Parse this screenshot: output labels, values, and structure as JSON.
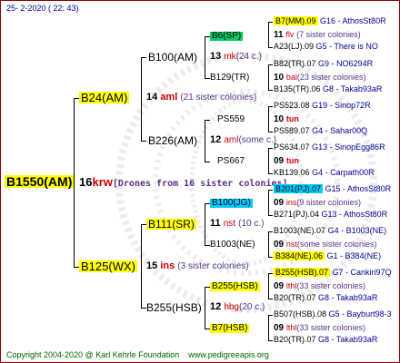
{
  "header": {
    "timestamp": "25-  2-2020 ( 22: 43)"
  },
  "root": {
    "name": "B1550(AM)",
    "num": "16",
    "code": "krw",
    "note": "[Drones from 16 sister colonies]"
  },
  "l1": [
    {
      "name": "B24(AM)",
      "num": "14",
      "code": "aml",
      "note": "(21 sister colonies)"
    },
    {
      "name": "B125(WX)",
      "num": "15",
      "code": "ins",
      "note": "(3 sister colonies)"
    }
  ],
  "l2": [
    {
      "name": "B100(AM)",
      "num": "13",
      "code": "mk",
      "note": "(24 c.)"
    },
    {
      "name": "B226(AM)",
      "num": "12",
      "code": "aml",
      "note": "(some c.)"
    },
    {
      "name": "B111(SR)",
      "num": "11",
      "code": "nst",
      "note": "(10 c.)"
    },
    {
      "name": "B255(HSB)",
      "num": "12",
      "code": "hbg",
      "note": "(20 c.)"
    }
  ],
  "l3": [
    {
      "name": "B6(SP)"
    },
    {
      "name": "B129(TR)"
    },
    {
      "name": "PS559"
    },
    {
      "name": "PS667"
    },
    {
      "name": "B100(JG)"
    },
    {
      "name": "B1003(NE)"
    },
    {
      "name": "B255(HSB)"
    },
    {
      "name": "B7(HSB)"
    }
  ],
  "l3info": [
    {
      "num": "11",
      "code": "flv",
      "note": "(7 sister colonies)"
    },
    {
      "num": "10",
      "code": "bal",
      "note": "(23 sister colonies)"
    },
    {
      "num": "10",
      "code": "tun",
      "note": ""
    },
    {
      "num": "09",
      "code": "tun",
      "note": ""
    },
    {
      "num": "09",
      "code": "ins",
      "note": "(9 sister colonies)"
    },
    {
      "num": "09",
      "code": "nst",
      "note": "(some sister colonies)"
    },
    {
      "num": "09",
      "code": "lthl",
      "note": "(33 sister colonies)"
    },
    {
      "num": "09",
      "code": "lthl",
      "note": "(33 sister colonies)"
    }
  ],
  "l4": [
    {
      "left": "B7(MM).09",
      "right": "G16 - AthosSt80R"
    },
    {
      "left": "A23(LJ).09",
      "right": "G5 - There is NO"
    },
    {
      "left": "B82(TR).07",
      "right": "G9 - NO6294R"
    },
    {
      "left": "B135(TR).06",
      "right": "G8 - Takab93aR"
    },
    {
      "left": "PS523.08",
      "right": "G19 - Sinop72R"
    },
    {
      "left": "PS589.07",
      "right": "G4 - Sahar00Q"
    },
    {
      "left": "PS634.07",
      "right": "G13 - SinopEgg86R"
    },
    {
      "left": "KB139.06",
      "right": "G4 - Carpath00R"
    },
    {
      "left": "B201(PJ).07",
      "right": "G15 - AthosSt80R"
    },
    {
      "left": "B271(PJ).04",
      "right": "G13 - AthosSt80R"
    },
    {
      "left": "B1003(NE).07",
      "right": "G4 - B1003(NE)"
    },
    {
      "left": "B384(NE).06",
      "right": "G1 - B384(NE)"
    },
    {
      "left": "B255(HSB).07",
      "right": "G7 - Cankiri97Q"
    },
    {
      "left": "B20(TR).07",
      "right": "G8 - Takab93aR"
    },
    {
      "left": "B507(HSB).08",
      "right": "G5 - Bayburt98-3"
    },
    {
      "left": "B20(TR).07",
      "right": "G8 - Takab93aR"
    }
  ],
  "footer": {
    "copyright": "Copyright 2004-2020 @ Karl Kehrle Foundation",
    "site": "www.pedigreeapis.org"
  },
  "colors": {
    "border": "#880000",
    "yellow": "#ffff00",
    "green": "#00cc66",
    "cyan": "#00ccff",
    "lime": "#66ff66"
  }
}
